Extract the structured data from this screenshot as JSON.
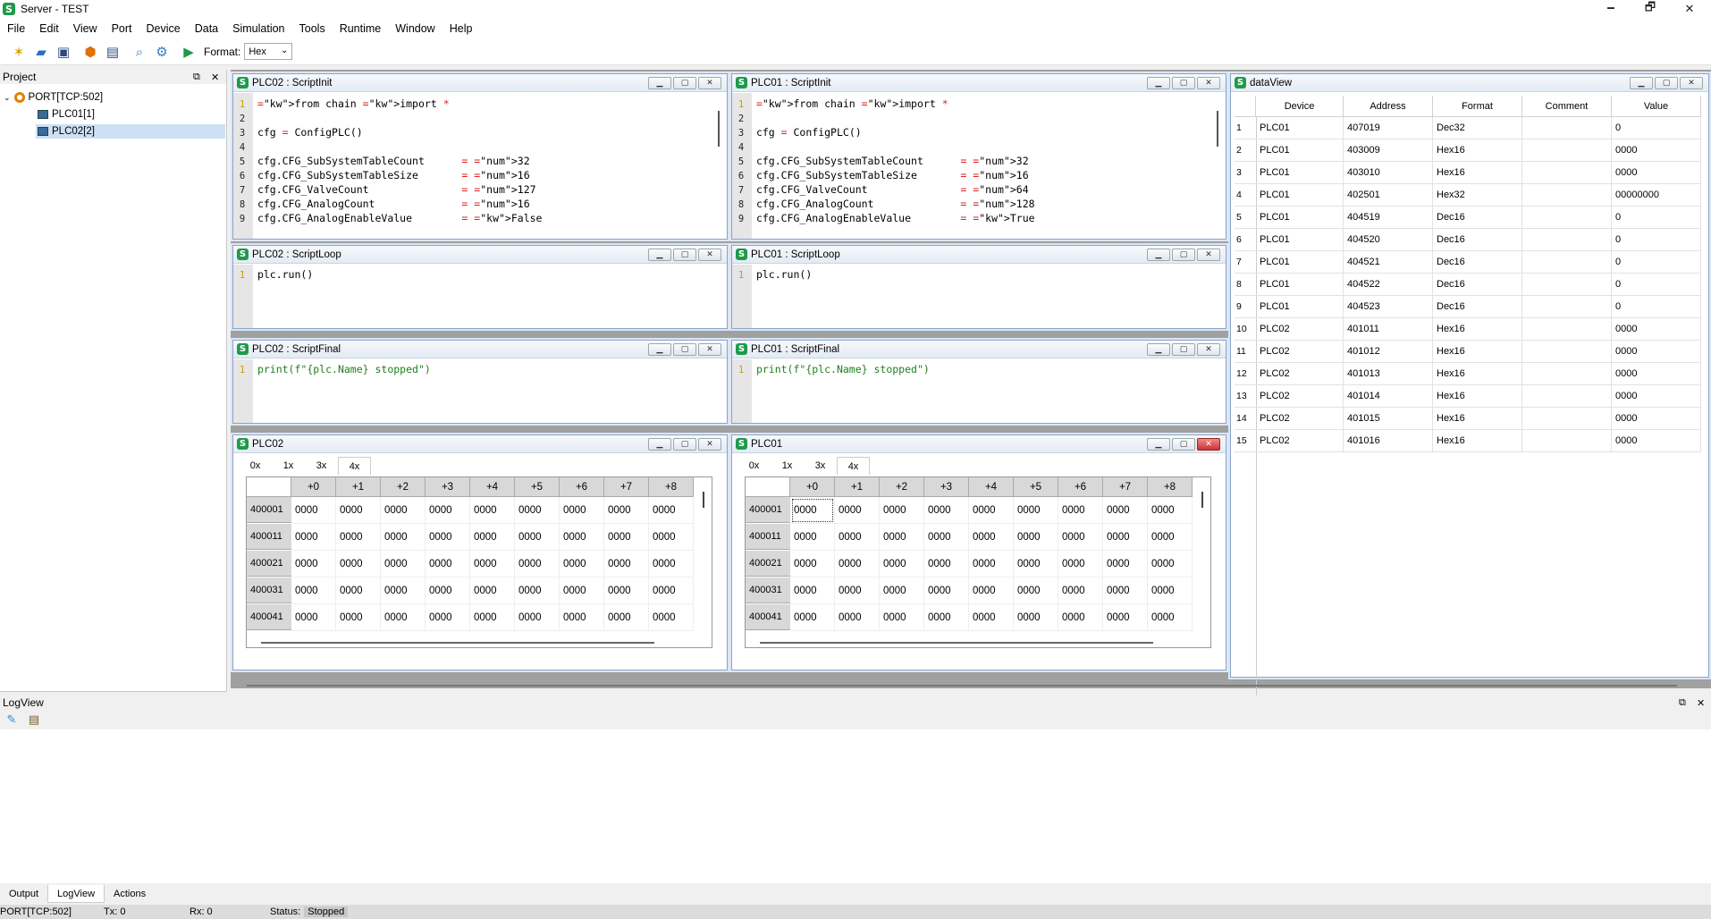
{
  "window": {
    "title": "Server - TEST",
    "minimize": "🗕",
    "maximize": "🗗",
    "close": "✕"
  },
  "menu": [
    "File",
    "Edit",
    "View",
    "Port",
    "Device",
    "Data",
    "Simulation",
    "Tools",
    "Runtime",
    "Window",
    "Help"
  ],
  "toolbar": {
    "format_label": "Format:",
    "format_value": "Hex",
    "icons": [
      "new-icon",
      "open-icon",
      "save-icon",
      "shield-icon",
      "monitor-icon",
      "search-icon",
      "search-settings-icon",
      "run-icon"
    ]
  },
  "project": {
    "title": "Project",
    "items": [
      {
        "label": "PORT[TCP:502]"
      },
      {
        "label": "PLC01[1]"
      },
      {
        "label": "PLC02[2]"
      }
    ]
  },
  "script_windows": {
    "plc02_init": {
      "title": "PLC02 : ScriptInit"
    },
    "plc01_init": {
      "title": "PLC01 : ScriptInit"
    },
    "plc02_loop": {
      "title": "PLC02 : ScriptLoop"
    },
    "plc01_loop": {
      "title": "PLC01 : ScriptLoop"
    },
    "plc02_final": {
      "title": "PLC02 : ScriptFinal"
    },
    "plc01_final": {
      "title": "PLC01 : ScriptFinal"
    }
  },
  "code": {
    "init_plc02": [
      [
        "1",
        "from chain import *"
      ],
      [
        "2",
        ""
      ],
      [
        "3",
        "cfg = ConfigPLC()"
      ],
      [
        "4",
        ""
      ],
      [
        "5",
        "cfg.CFG_SubSystemTableCount      = 32"
      ],
      [
        "6",
        "cfg.CFG_SubSystemTableSize       = 16"
      ],
      [
        "7",
        "cfg.CFG_ValveCount               = 127"
      ],
      [
        "8",
        "cfg.CFG_AnalogCount              = 16"
      ],
      [
        "9",
        "cfg.CFG_AnalogEnableValue        = False"
      ]
    ],
    "init_plc01": [
      [
        "1",
        "from chain import *"
      ],
      [
        "2",
        ""
      ],
      [
        "3",
        "cfg = ConfigPLC()"
      ],
      [
        "4",
        ""
      ],
      [
        "5",
        "cfg.CFG_SubSystemTableCount      = 32"
      ],
      [
        "6",
        "cfg.CFG_SubSystemTableSize       = 16"
      ],
      [
        "7",
        "cfg.CFG_ValveCount               = 64"
      ],
      [
        "8",
        "cfg.CFG_AnalogCount              = 128"
      ],
      [
        "9",
        "cfg.CFG_AnalogEnableValue        = True"
      ]
    ],
    "loop_line": "plc.run()",
    "final_line": "print(f\"{plc.Name} stopped\")"
  },
  "plc02_grid": {
    "title": "PLC02",
    "tabs": [
      "0x",
      "1x",
      "3x",
      "4x"
    ],
    "cols": [
      "+0",
      "+1",
      "+2",
      "+3",
      "+4",
      "+5",
      "+6",
      "+7",
      "+8"
    ],
    "rows": [
      "400001",
      "400011",
      "400021",
      "400031",
      "400041"
    ],
    "cell": "0000"
  },
  "plc01_grid": {
    "title": "PLC01",
    "tabs": [
      "0x",
      "1x",
      "3x",
      "4x"
    ],
    "cols": [
      "+0",
      "+1",
      "+2",
      "+3",
      "+4",
      "+5",
      "+6",
      "+7",
      "+8"
    ],
    "rows": [
      "400001",
      "400011",
      "400021",
      "400031",
      "400041"
    ],
    "cell": "0000"
  },
  "dataview": {
    "title": "dataView",
    "headers": [
      "Device",
      "Address",
      "Format",
      "Comment",
      "Value"
    ],
    "rows": [
      [
        "1",
        "PLC01",
        "407019",
        "Dec32",
        "",
        "0"
      ],
      [
        "2",
        "PLC01",
        "403009",
        "Hex16",
        "",
        "0000"
      ],
      [
        "3",
        "PLC01",
        "403010",
        "Hex16",
        "",
        "0000"
      ],
      [
        "4",
        "PLC01",
        "402501",
        "Hex32",
        "",
        "00000000"
      ],
      [
        "5",
        "PLC01",
        "404519",
        "Dec16",
        "",
        "0"
      ],
      [
        "6",
        "PLC01",
        "404520",
        "Dec16",
        "",
        "0"
      ],
      [
        "7",
        "PLC01",
        "404521",
        "Dec16",
        "",
        "0"
      ],
      [
        "8",
        "PLC01",
        "404522",
        "Dec16",
        "",
        "0"
      ],
      [
        "9",
        "PLC01",
        "404523",
        "Dec16",
        "",
        "0"
      ],
      [
        "10",
        "PLC02",
        "401011",
        "Hex16",
        "",
        "0000"
      ],
      [
        "11",
        "PLC02",
        "401012",
        "Hex16",
        "",
        "0000"
      ],
      [
        "12",
        "PLC02",
        "401013",
        "Hex16",
        "",
        "0000"
      ],
      [
        "13",
        "PLC02",
        "401014",
        "Hex16",
        "",
        "0000"
      ],
      [
        "14",
        "PLC02",
        "401015",
        "Hex16",
        "",
        "0000"
      ],
      [
        "15",
        "PLC02",
        "401016",
        "Hex16",
        "",
        "0000"
      ]
    ]
  },
  "logview": {
    "title": "LogView"
  },
  "bottom_tabs": [
    "Output",
    "LogView",
    "Actions"
  ],
  "status": {
    "port": "PORT[TCP:502]",
    "tx": "Tx:  0",
    "rx": "Rx:  0",
    "status_label": "Status:",
    "status_value": "Stopped"
  }
}
